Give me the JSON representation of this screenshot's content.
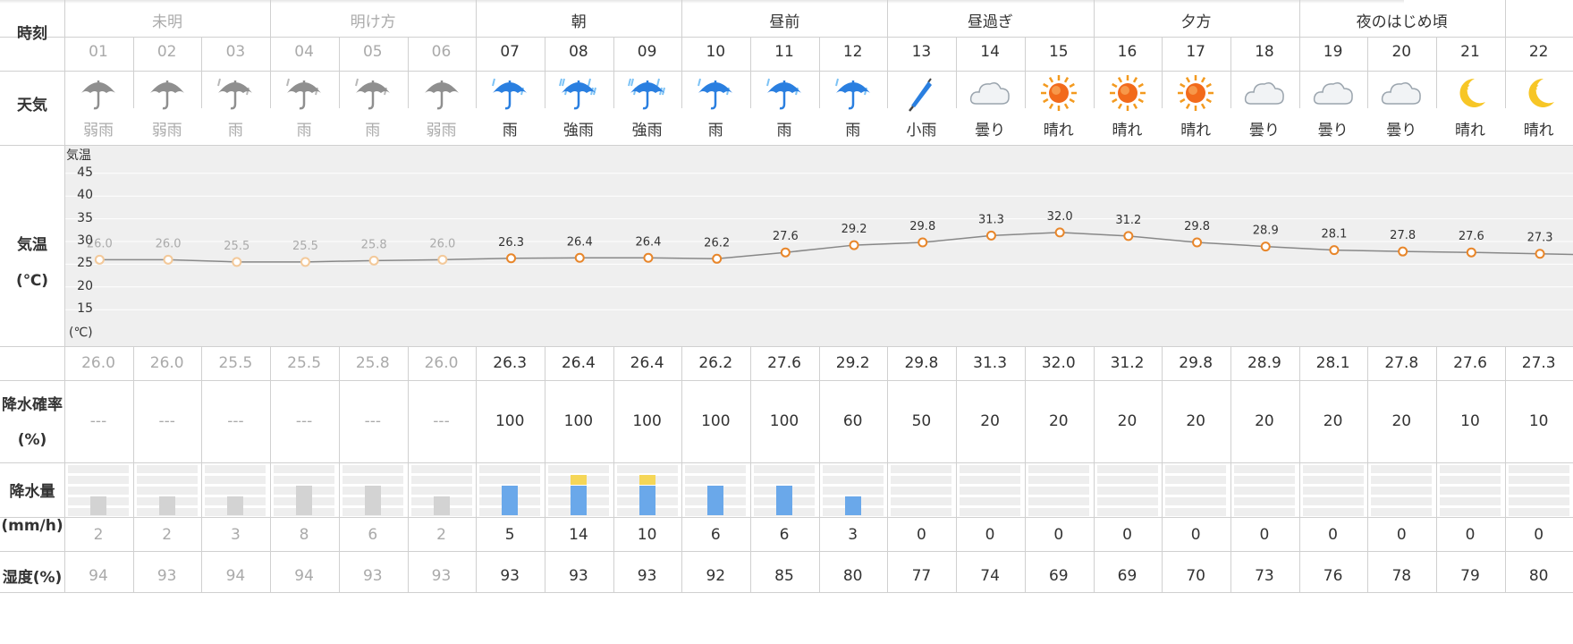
{
  "labels": {
    "time": "時刻",
    "weather": "天気",
    "temp_line1": "気温",
    "temp_line2": "(℃)",
    "precip_prob_line1": "降水確率",
    "precip_prob_line2": "(%)",
    "precip_amt_line1": "降水量",
    "precip_amt_line2": "(mm/h)",
    "humidity": "湿度(%)"
  },
  "periods": [
    "未明",
    "明け方",
    "朝",
    "昼前",
    "昼過ぎ",
    "夕方",
    "夜のはじめ頃"
  ],
  "hours": [
    "01",
    "02",
    "03",
    "04",
    "05",
    "06",
    "07",
    "08",
    "09",
    "10",
    "11",
    "12",
    "13",
    "14",
    "15",
    "16",
    "17",
    "18",
    "19",
    "20",
    "21",
    "22"
  ],
  "weather": [
    {
      "text": "弱雨",
      "icon": "umbrella-gray-icon"
    },
    {
      "text": "弱雨",
      "icon": "umbrella-gray-icon"
    },
    {
      "text": "雨",
      "icon": "umbrella-gray-rain-icon"
    },
    {
      "text": "雨",
      "icon": "umbrella-gray-rain-icon"
    },
    {
      "text": "雨",
      "icon": "umbrella-gray-rain-icon"
    },
    {
      "text": "弱雨",
      "icon": "umbrella-gray-icon"
    },
    {
      "text": "雨",
      "icon": "umbrella-blue-rain-icon"
    },
    {
      "text": "強雨",
      "icon": "umbrella-blue-heavy-rain-icon"
    },
    {
      "text": "強雨",
      "icon": "umbrella-blue-heavy-rain-icon"
    },
    {
      "text": "雨",
      "icon": "umbrella-blue-rain-icon"
    },
    {
      "text": "雨",
      "icon": "umbrella-blue-rain-icon"
    },
    {
      "text": "雨",
      "icon": "umbrella-blue-rain-icon"
    },
    {
      "text": "小雨",
      "icon": "closed-umbrella-icon"
    },
    {
      "text": "曇り",
      "icon": "cloud-icon"
    },
    {
      "text": "晴れ",
      "icon": "sun-icon"
    },
    {
      "text": "晴れ",
      "icon": "sun-icon"
    },
    {
      "text": "晴れ",
      "icon": "sun-icon"
    },
    {
      "text": "曇り",
      "icon": "cloud-icon"
    },
    {
      "text": "曇り",
      "icon": "cloud-icon"
    },
    {
      "text": "曇り",
      "icon": "cloud-icon"
    },
    {
      "text": "晴れ",
      "icon": "moon-icon"
    },
    {
      "text": "晴れ",
      "icon": "moon-icon"
    }
  ],
  "temps": [
    "26.0",
    "26.0",
    "25.5",
    "25.5",
    "25.8",
    "26.0",
    "26.3",
    "26.4",
    "26.4",
    "26.2",
    "27.6",
    "29.2",
    "29.8",
    "31.3",
    "32.0",
    "31.2",
    "29.8",
    "28.9",
    "28.1",
    "27.8",
    "27.6",
    "27.3"
  ],
  "precip_prob": [
    "---",
    "---",
    "---",
    "---",
    "---",
    "---",
    "100",
    "100",
    "100",
    "100",
    "100",
    "60",
    "50",
    "20",
    "20",
    "20",
    "20",
    "20",
    "20",
    "20",
    "10",
    "10"
  ],
  "precip_amt": [
    "2",
    "2",
    "3",
    "8",
    "6",
    "2",
    "5",
    "14",
    "10",
    "6",
    "6",
    "3",
    "0",
    "0",
    "0",
    "0",
    "0",
    "0",
    "0",
    "0",
    "0",
    "0"
  ],
  "humidity": [
    "94",
    "93",
    "94",
    "94",
    "93",
    "93",
    "93",
    "93",
    "93",
    "92",
    "85",
    "80",
    "77",
    "74",
    "69",
    "69",
    "70",
    "73",
    "76",
    "78",
    "79",
    "80"
  ],
  "chart_data": {
    "type": "line",
    "title": "",
    "ylabel_top": "気温",
    "ylabel_bottom": "(℃)",
    "y_ticks": [
      "45",
      "40",
      "35",
      "30",
      "25",
      "20",
      "15"
    ],
    "ylim": [
      10,
      48
    ],
    "x": [
      "01",
      "02",
      "03",
      "04",
      "05",
      "06",
      "07",
      "08",
      "09",
      "10",
      "11",
      "12",
      "13",
      "14",
      "15",
      "16",
      "17",
      "18",
      "19",
      "20",
      "21",
      "22"
    ],
    "series": [
      {
        "values": [
          26.0,
          26.0,
          25.5,
          25.5,
          25.8,
          26.0,
          26.3,
          26.4,
          26.4,
          26.2,
          27.6,
          29.2,
          29.8,
          31.3,
          32.0,
          31.2,
          29.8,
          28.9,
          28.1,
          27.8,
          27.6,
          27.3
        ]
      }
    ],
    "grid": true
  },
  "colors": {
    "past_text": "#aaaaaa",
    "current_text": "#333333",
    "line": "#888888",
    "marker": "#e8862a",
    "marker_past": "#f3c99a",
    "rain_bar": "#6aa8ea",
    "heavy_bar": "#f5d657",
    "past_bar": "#d3d3d3"
  }
}
